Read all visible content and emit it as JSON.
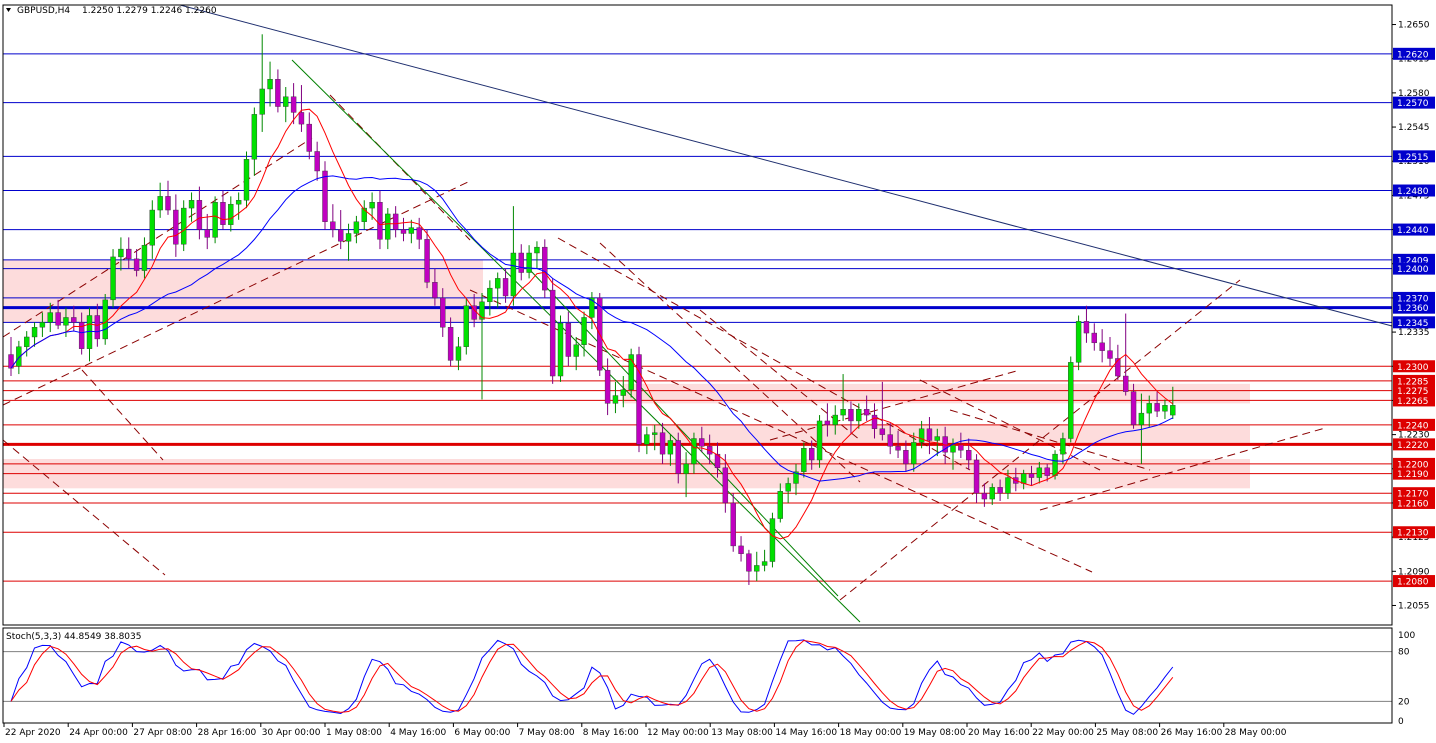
{
  "header": {
    "symbol": "GBPUSD,H4",
    "ohlc": "1.2250 1.2279 1.2246 1.2260"
  },
  "stoch": {
    "label": "Stoch(5,3,3) 44.8549 38.8035",
    "axis_labels": [
      "100",
      "80",
      "20",
      "0"
    ],
    "main_color": "#0000ff",
    "signal_color": "#ff0000"
  },
  "x_axis": {
    "labels": [
      "22 Apr 2020",
      "24 Apr 00:00",
      "27 Apr 08:00",
      "28 Apr 16:00",
      "30 Apr 00:00",
      "1 May 08:00",
      "4 May 16:00",
      "6 May 00:00",
      "7 May 08:00",
      "8 May 16:00",
      "12 May 00:00",
      "13 May 08:00",
      "14 May 16:00",
      "18 May 00:00",
      "19 May 08:00",
      "20 May 16:00",
      "22 May 00:00",
      "25 May 08:00",
      "26 May 16:00",
      "28 May 00:00"
    ]
  },
  "y_axis": {
    "ticks": [
      "1.2650",
      "1.2615",
      "1.2580",
      "1.2545",
      "1.2510",
      "1.2475",
      "1.2440",
      "1.2405",
      "1.2370",
      "1.2335",
      "1.2300",
      "1.2265",
      "1.2230",
      "1.2195",
      "1.2160",
      "1.2125",
      "1.2090",
      "1.2055"
    ]
  },
  "levels": {
    "blue": [
      "1.2620",
      "1.2570",
      "1.2515",
      "1.2480",
      "1.2440",
      "1.2409",
      "1.2400",
      "1.2370",
      "1.2360",
      "1.2345"
    ],
    "red": [
      "1.2300",
      "1.2285",
      "1.2275",
      "1.2265",
      "1.2240",
      "1.2220",
      "1.2200",
      "1.2190",
      "1.2170",
      "1.2160",
      "1.2130",
      "1.2080"
    ]
  },
  "colors": {
    "bull": "#00e000",
    "bear": "#c000c0",
    "blue_line": "#0000cc",
    "red_line": "#dd0000",
    "zone": "#fddcdc",
    "ma_fast": "#ff0000",
    "ma_slow": "#0000ff",
    "trend": "#8b0000",
    "green_line": "#008000",
    "label_blue": "#0000cc",
    "label_red": "#dd0000"
  },
  "chart_data": {
    "type": "candlestick",
    "symbol": "GBPUSD",
    "timeframe": "H4",
    "ylim": [
      1.2035,
      1.267
    ],
    "candles": [
      [
        1.2312,
        1.233,
        1.229,
        1.2298
      ],
      [
        1.23,
        1.2326,
        1.2292,
        1.232
      ],
      [
        1.232,
        1.2336,
        1.231,
        1.233
      ],
      [
        1.233,
        1.2345,
        1.232,
        1.234
      ],
      [
        1.234,
        1.2355,
        1.233,
        1.2345
      ],
      [
        1.2345,
        1.2365,
        1.2335,
        1.2355
      ],
      [
        1.2355,
        1.2368,
        1.2338,
        1.2342
      ],
      [
        1.2342,
        1.236,
        1.233,
        1.235
      ],
      [
        1.235,
        1.2362,
        1.2336,
        1.2345
      ],
      [
        1.2345,
        1.2355,
        1.2312,
        1.2318
      ],
      [
        1.2318,
        1.236,
        1.2305,
        1.2352
      ],
      [
        1.2352,
        1.2364,
        1.232,
        1.2328
      ],
      [
        1.2328,
        1.2374,
        1.2322,
        1.2368
      ],
      [
        1.2368,
        1.242,
        1.236,
        1.2412
      ],
      [
        1.2412,
        1.2432,
        1.2398,
        1.242
      ],
      [
        1.242,
        1.2432,
        1.24,
        1.241
      ],
      [
        1.241,
        1.242,
        1.2392,
        1.2398
      ],
      [
        1.2398,
        1.2432,
        1.239,
        1.2424
      ],
      [
        1.2424,
        1.247,
        1.241,
        1.246
      ],
      [
        1.246,
        1.2488,
        1.2452,
        1.2474
      ],
      [
        1.2474,
        1.249,
        1.2455,
        1.246
      ],
      [
        1.246,
        1.2476,
        1.2412,
        1.2425
      ],
      [
        1.2425,
        1.247,
        1.2418,
        1.2462
      ],
      [
        1.2462,
        1.2478,
        1.2448,
        1.247
      ],
      [
        1.247,
        1.2484,
        1.243,
        1.244
      ],
      [
        1.244,
        1.2456,
        1.242,
        1.2432
      ],
      [
        1.2432,
        1.2474,
        1.2426,
        1.2468
      ],
      [
        1.2468,
        1.248,
        1.244,
        1.2445
      ],
      [
        1.2445,
        1.2474,
        1.2438,
        1.2466
      ],
      [
        1.2466,
        1.2478,
        1.245,
        1.247
      ],
      [
        1.247,
        1.252,
        1.2462,
        1.2512
      ],
      [
        1.2512,
        1.2565,
        1.2495,
        1.2558
      ],
      [
        1.2558,
        1.264,
        1.254,
        1.2584
      ],
      [
        1.2584,
        1.2612,
        1.2566,
        1.2594
      ],
      [
        1.2594,
        1.2604,
        1.256,
        1.2566
      ],
      [
        1.2566,
        1.2586,
        1.255,
        1.2576
      ],
      [
        1.2576,
        1.259,
        1.2548,
        1.256
      ],
      [
        1.256,
        1.2588,
        1.254,
        1.2548
      ],
      [
        1.2548,
        1.256,
        1.2512,
        1.252
      ],
      [
        1.252,
        1.253,
        1.249,
        1.25
      ],
      [
        1.25,
        1.251,
        1.244,
        1.2448
      ],
      [
        1.2448,
        1.2466,
        1.2432,
        1.244
      ],
      [
        1.244,
        1.246,
        1.242,
        1.2428
      ],
      [
        1.2428,
        1.2446,
        1.2408,
        1.2436
      ],
      [
        1.2436,
        1.2454,
        1.2426,
        1.2448
      ],
      [
        1.2448,
        1.247,
        1.244,
        1.2462
      ],
      [
        1.2462,
        1.2478,
        1.245,
        1.2468
      ],
      [
        1.2468,
        1.248,
        1.242,
        1.243
      ],
      [
        1.243,
        1.2462,
        1.242,
        1.2456
      ],
      [
        1.2456,
        1.2464,
        1.2432,
        1.244
      ],
      [
        1.244,
        1.2452,
        1.2428,
        1.2436
      ],
      [
        1.2436,
        1.245,
        1.2426,
        1.2442
      ],
      [
        1.2442,
        1.2452,
        1.242,
        1.243
      ],
      [
        1.243,
        1.244,
        1.238,
        1.2386
      ],
      [
        1.2386,
        1.24,
        1.2362,
        1.237
      ],
      [
        1.237,
        1.238,
        1.233,
        1.234
      ],
      [
        1.234,
        1.235,
        1.23,
        1.2306
      ],
      [
        1.2306,
        1.233,
        1.2296,
        1.232
      ],
      [
        1.232,
        1.237,
        1.2312,
        1.2362
      ],
      [
        1.2362,
        1.2374,
        1.234,
        1.2348
      ],
      [
        1.2348,
        1.2375,
        1.2266,
        1.2366
      ],
      [
        1.2366,
        1.2388,
        1.2352,
        1.238
      ],
      [
        1.238,
        1.2396,
        1.236,
        1.239
      ],
      [
        1.239,
        1.24,
        1.2365,
        1.2372
      ],
      [
        1.2372,
        1.2464,
        1.2362,
        1.2416
      ],
      [
        1.2416,
        1.2425,
        1.2388,
        1.2396
      ],
      [
        1.2396,
        1.2424,
        1.239,
        1.2416
      ],
      [
        1.2416,
        1.2428,
        1.24,
        1.2422
      ],
      [
        1.2422,
        1.243,
        1.237,
        1.2378
      ],
      [
        1.2378,
        1.239,
        1.2282,
        1.229
      ],
      [
        1.229,
        1.2352,
        1.2284,
        1.2344
      ],
      [
        1.2344,
        1.2356,
        1.23,
        1.231
      ],
      [
        1.231,
        1.233,
        1.2296,
        1.2322
      ],
      [
        1.2322,
        1.2356,
        1.231,
        1.235
      ],
      [
        1.235,
        1.2376,
        1.2338,
        1.237
      ],
      [
        1.237,
        1.2375,
        1.229,
        1.2296
      ],
      [
        1.2296,
        1.2308,
        1.225,
        1.2262
      ],
      [
        1.2262,
        1.2284,
        1.2252,
        1.227
      ],
      [
        1.227,
        1.229,
        1.2258,
        1.2276
      ],
      [
        1.2276,
        1.2318,
        1.2268,
        1.2312
      ],
      [
        1.2312,
        1.232,
        1.2212,
        1.222
      ],
      [
        1.222,
        1.2238,
        1.221,
        1.223
      ],
      [
        1.223,
        1.224,
        1.2214,
        1.2232
      ],
      [
        1.2232,
        1.2242,
        1.22,
        1.221
      ],
      [
        1.221,
        1.223,
        1.2198,
        1.2224
      ],
      [
        1.2224,
        1.2232,
        1.218,
        1.219
      ],
      [
        1.219,
        1.2212,
        1.2166,
        1.22
      ],
      [
        1.22,
        1.2232,
        1.219,
        1.2226
      ],
      [
        1.2226,
        1.2238,
        1.2212,
        1.2218
      ],
      [
        1.2218,
        1.223,
        1.22,
        1.221
      ],
      [
        1.221,
        1.2222,
        1.2186,
        1.2196
      ],
      [
        1.2196,
        1.221,
        1.215,
        1.216
      ],
      [
        1.216,
        1.217,
        1.211,
        1.2116
      ],
      [
        1.2116,
        1.2126,
        1.21,
        1.2108
      ],
      [
        1.2108,
        1.2112,
        1.2076,
        1.209
      ],
      [
        1.209,
        1.211,
        1.208,
        1.2096
      ],
      [
        1.2096,
        1.2112,
        1.209,
        1.21
      ],
      [
        1.21,
        1.215,
        1.2094,
        1.2144
      ],
      [
        1.2144,
        1.218,
        1.214,
        1.2172
      ],
      [
        1.2172,
        1.2186,
        1.216,
        1.218
      ],
      [
        1.218,
        1.22,
        1.2168,
        1.2192
      ],
      [
        1.2192,
        1.2222,
        1.2186,
        1.2216
      ],
      [
        1.2216,
        1.2224,
        1.2194,
        1.2204
      ],
      [
        1.2204,
        1.225,
        1.2196,
        1.2244
      ],
      [
        1.2244,
        1.2262,
        1.2228,
        1.224
      ],
      [
        1.224,
        1.226,
        1.223,
        1.225
      ],
      [
        1.225,
        1.2292,
        1.2244,
        1.2256
      ],
      [
        1.2256,
        1.2264,
        1.223,
        1.2244
      ],
      [
        1.2244,
        1.2262,
        1.2236,
        1.2256
      ],
      [
        1.2256,
        1.227,
        1.2244,
        1.225
      ],
      [
        1.225,
        1.2262,
        1.2226,
        1.2236
      ],
      [
        1.2236,
        1.2284,
        1.2224,
        1.223
      ],
      [
        1.223,
        1.2242,
        1.221,
        1.2218
      ],
      [
        1.2218,
        1.2234,
        1.2206,
        1.2214
      ],
      [
        1.2214,
        1.2224,
        1.2192,
        1.22
      ],
      [
        1.22,
        1.2232,
        1.2192,
        1.2222
      ],
      [
        1.2222,
        1.2244,
        1.2216,
        1.2236
      ],
      [
        1.2236,
        1.2248,
        1.221,
        1.2224
      ],
      [
        1.2224,
        1.2236,
        1.2208,
        1.2228
      ],
      [
        1.2228,
        1.2238,
        1.22,
        1.2212
      ],
      [
        1.2212,
        1.2226,
        1.2194,
        1.222
      ],
      [
        1.222,
        1.2232,
        1.2206,
        1.2214
      ],
      [
        1.2214,
        1.2226,
        1.2194,
        1.2204
      ],
      [
        1.2204,
        1.221,
        1.216,
        1.217
      ],
      [
        1.217,
        1.218,
        1.2156,
        1.2164
      ],
      [
        1.2164,
        1.218,
        1.2158,
        1.2176
      ],
      [
        1.2176,
        1.2184,
        1.2162,
        1.217
      ],
      [
        1.217,
        1.2194,
        1.2164,
        1.2186
      ],
      [
        1.2186,
        1.2196,
        1.2172,
        1.218
      ],
      [
        1.218,
        1.2194,
        1.2174,
        1.219
      ],
      [
        1.219,
        1.2198,
        1.2178,
        1.2186
      ],
      [
        1.2186,
        1.2202,
        1.218,
        1.2196
      ],
      [
        1.2196,
        1.22,
        1.2182,
        1.2188
      ],
      [
        1.2188,
        1.2214,
        1.2184,
        1.221
      ],
      [
        1.221,
        1.2232,
        1.22,
        1.2226
      ],
      [
        1.2226,
        1.231,
        1.2222,
        1.2304
      ],
      [
        1.2304,
        1.2352,
        1.2296,
        1.2346
      ],
      [
        1.2346,
        1.2362,
        1.2324,
        1.2334
      ],
      [
        1.2334,
        1.2344,
        1.2316,
        1.2324
      ],
      [
        1.2324,
        1.2338,
        1.2304,
        1.2316
      ],
      [
        1.2316,
        1.233,
        1.23,
        1.2308
      ],
      [
        1.2308,
        1.2322,
        1.2286,
        1.229
      ],
      [
        1.229,
        1.2354,
        1.227,
        1.2274
      ],
      [
        1.2274,
        1.2282,
        1.2236,
        1.224
      ],
      [
        1.224,
        1.2272,
        1.22,
        1.2252
      ],
      [
        1.2252,
        1.227,
        1.2238,
        1.2262
      ],
      [
        1.2262,
        1.2274,
        1.2248,
        1.2254
      ],
      [
        1.2254,
        1.2266,
        1.2246,
        1.226
      ],
      [
        1.225,
        1.2279,
        1.2246,
        1.226
      ]
    ]
  }
}
